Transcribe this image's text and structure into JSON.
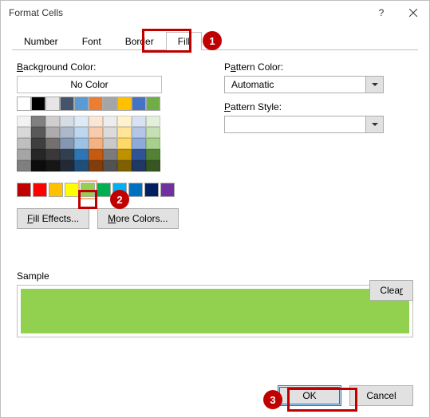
{
  "title": "Format Cells",
  "tabs": [
    "Number",
    "Font",
    "Border",
    "Fill"
  ],
  "activeTab": "Fill",
  "labels": {
    "bgColor": "Background Color:",
    "noColor": "No Color",
    "patternColor": "Pattern Color:",
    "patternStyle": "Pattern Style:",
    "fillEffects": "Fill Effects...",
    "moreColors": "More Colors...",
    "sample": "Sample",
    "clear": "Clear",
    "ok": "OK",
    "cancel": "Cancel"
  },
  "patternColorValue": "Automatic",
  "patternStyleValue": "",
  "sampleColor": "#92d050",
  "callouts": {
    "c1": "1",
    "c2": "2",
    "c3": "3"
  },
  "themeRow": [
    "#ffffff",
    "#000000",
    "#e7e6e6",
    "#44546a",
    "#5b9bd5",
    "#ed7d31",
    "#a5a5a5",
    "#ffc000",
    "#4472c4",
    "#70ad47"
  ],
  "themeShades": [
    [
      "#f2f2f2",
      "#808080",
      "#d0cece",
      "#d6dce4",
      "#deebf6",
      "#fbe5d5",
      "#ededed",
      "#fff2cc",
      "#d9e2f3",
      "#e2efd9"
    ],
    [
      "#d8d8d8",
      "#595959",
      "#aeabab",
      "#adb9ca",
      "#bdd7ee",
      "#f7cbac",
      "#dbdbdb",
      "#fee599",
      "#b4c6e7",
      "#c5e0b3"
    ],
    [
      "#bfbfbf",
      "#3f3f3f",
      "#757070",
      "#8496b0",
      "#9cc3e5",
      "#f4b183",
      "#c9c9c9",
      "#ffd965",
      "#8eaadb",
      "#a8d08d"
    ],
    [
      "#a5a5a5",
      "#262626",
      "#3a3838",
      "#323f4f",
      "#2e75b5",
      "#c55a11",
      "#7b7b7b",
      "#bf9000",
      "#2f5496",
      "#538135"
    ],
    [
      "#7f7f7f",
      "#0c0c0c",
      "#171616",
      "#222a35",
      "#1e4e79",
      "#833c0b",
      "#525252",
      "#7f6000",
      "#1f3864",
      "#375623"
    ]
  ],
  "standardColors": [
    "#c00000",
    "#ff0000",
    "#ffc000",
    "#ffff00",
    "#92d050",
    "#00b050",
    "#00b0f0",
    "#0070c0",
    "#002060",
    "#7030a0"
  ],
  "selectedStandardIndex": 4
}
